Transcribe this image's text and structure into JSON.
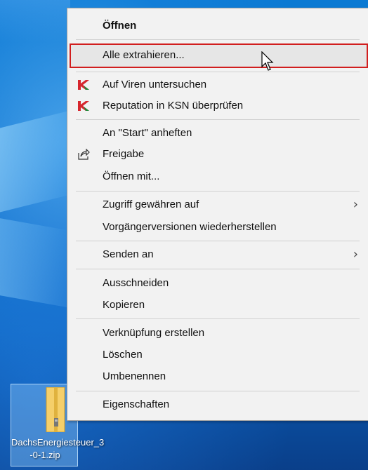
{
  "context_menu": {
    "items": [
      {
        "label": "Öffnen"
      },
      {
        "label": "Alle extrahieren..."
      },
      {
        "label": "Auf Viren untersuchen"
      },
      {
        "label": "Reputation in KSN überprüfen"
      },
      {
        "label": "An \"Start\" anheften"
      },
      {
        "label": "Freigabe"
      },
      {
        "label": "Öffnen mit..."
      },
      {
        "label": "Zugriff gewähren auf"
      },
      {
        "label": "Vorgängerversionen wiederherstellen"
      },
      {
        "label": "Senden an"
      },
      {
        "label": "Ausschneiden"
      },
      {
        "label": "Kopieren"
      },
      {
        "label": "Verknüpfung erstellen"
      },
      {
        "label": "Löschen"
      },
      {
        "label": "Umbenennen"
      },
      {
        "label": "Eigenschaften"
      }
    ],
    "submenu_arrow": "›",
    "highlight_color": "#d11e1e"
  },
  "icons": {
    "kaspersky": "kaspersky-icon",
    "share": "share-icon",
    "zip": "zip-folder-icon",
    "cursor": "mouse-cursor-icon"
  },
  "desktop": {
    "file_name_line1": "DachsEnergiesteuer_3",
    "file_name_line2": "-0-1.zip"
  }
}
